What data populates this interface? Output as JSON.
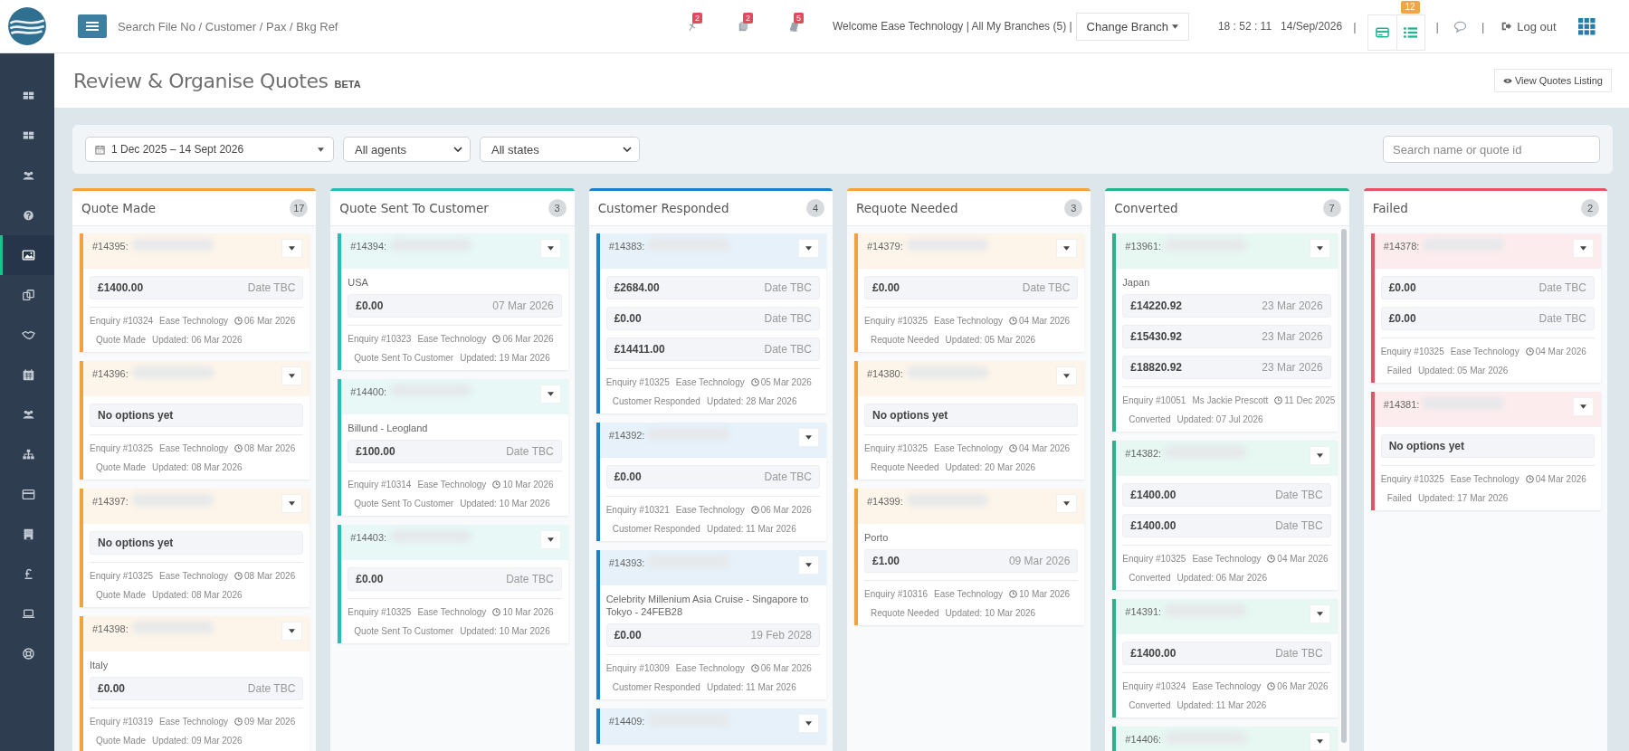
{
  "topbar": {
    "search": {
      "placeholder": "Search File No / Customer / Pax / Bkg Ref"
    },
    "notifications": [
      {
        "count": "2"
      },
      {
        "count": "2"
      },
      {
        "count": "5"
      }
    ],
    "welcome": "Welcome Ease Technology | All My Branches (5) |",
    "change_branch": "Change Branch",
    "time": "18 : 52 : 11",
    "date": "14/Sep/2026",
    "separator": "|",
    "view_badge": "12",
    "logout": "Log out"
  },
  "sidebar": {
    "items": [
      {
        "selected": false
      },
      {
        "selected": false
      },
      {
        "selected": false
      },
      {
        "selected": false
      },
      {
        "selected": true
      },
      {
        "selected": false
      },
      {
        "selected": false
      },
      {
        "selected": false
      },
      {
        "selected": false
      },
      {
        "selected": false
      },
      {
        "selected": false
      },
      {
        "selected": false
      },
      {
        "selected": false
      },
      {
        "selected": false
      },
      {
        "selected": false
      }
    ]
  },
  "page": {
    "title": "Review & Organise Quotes",
    "tag": "BETA",
    "view_button": "View Quotes Listing"
  },
  "filters": {
    "date_range": "1 Dec 2025 – 14 Sept 2026",
    "agents": "All agents",
    "states": "All states",
    "search": {
      "placeholder": "Search name or quote id"
    }
  },
  "columns": [
    {
      "title": "Quote Made",
      "count": "17",
      "color": "#f0a33c",
      "cards": [
        {
          "ref": "#14395:",
          "options": [
            {
              "price": "£1400.00",
              "date": "Date TBC"
            }
          ],
          "enquiry": "Enquiry #10324",
          "agent": "Ease Technology",
          "created": "06 Mar 2026",
          "status": "Quote Made",
          "updated": "Updated: 06 Mar 2026"
        },
        {
          "ref": "#14396:",
          "empty_text": "No options yet",
          "enquiry": "Enquiry #10325",
          "agent": "Ease Technology",
          "created": "08 Mar 2026",
          "status": "Quote Made",
          "updated": "Updated: 08 Mar 2026"
        },
        {
          "ref": "#14397:",
          "empty_text": "No options yet",
          "enquiry": "Enquiry #10325",
          "agent": "Ease Technology",
          "created": "08 Mar 2026",
          "status": "Quote Made",
          "updated": "Updated: 08 Mar 2026"
        },
        {
          "ref": "#14398:",
          "destination": "Italy",
          "options": [
            {
              "price": "£0.00",
              "date": "Date TBC"
            }
          ],
          "enquiry": "Enquiry #10319",
          "agent": "Ease Technology",
          "created": "09 Mar 2026",
          "status": "Quote Made",
          "updated": "Updated: 09 Mar 2026"
        }
      ]
    },
    {
      "title": "Quote Sent To Customer",
      "count": "3",
      "color": "#22c0b4",
      "cards": [
        {
          "ref": "#14394:",
          "destination": "USA",
          "options": [
            {
              "price": "£0.00",
              "date": "07 Mar 2026"
            }
          ],
          "enquiry": "Enquiry #10323",
          "agent": "Ease Technology",
          "created": "06 Mar 2026",
          "status": "Quote Sent To Customer",
          "updated": "Updated: 19 Mar 2026"
        },
        {
          "ref": "#14400:",
          "destination": "Billund - Leogland",
          "options": [
            {
              "price": "£100.00",
              "date": "Date TBC"
            }
          ],
          "enquiry": "Enquiry #10314",
          "agent": "Ease Technology",
          "created": "10 Mar 2026",
          "status": "Quote Sent To Customer",
          "updated": "Updated: 10 Mar 2026"
        },
        {
          "ref": "#14403:",
          "options": [
            {
              "price": "£0.00",
              "date": "Date TBC"
            }
          ],
          "enquiry": "Enquiry #10325",
          "agent": "Ease Technology",
          "created": "10 Mar 2026",
          "status": "Quote Sent To Customer",
          "updated": "Updated: 10 Mar 2026"
        }
      ]
    },
    {
      "title": "Customer Responded",
      "count": "4",
      "color": "#1f7fc4",
      "cards": [
        {
          "ref": "#14383:",
          "options": [
            {
              "price": "£2684.00",
              "date": "Date TBC"
            },
            {
              "price": "£0.00",
              "date": "Date TBC"
            },
            {
              "price": "£14411.00",
              "date": "Date TBC"
            }
          ],
          "enquiry": "Enquiry #10325",
          "agent": "Ease Technology",
          "created": "05 Mar 2026",
          "status": "Customer Responded",
          "updated": "Updated: 28 Mar 2026"
        },
        {
          "ref": "#14392:",
          "options": [
            {
              "price": "£0.00",
              "date": "Date TBC"
            }
          ],
          "enquiry": "Enquiry #10321",
          "agent": "Ease Technology",
          "created": "06 Mar 2026",
          "status": "Customer Responded",
          "updated": "Updated: 11 Mar 2026"
        },
        {
          "ref": "#14393:",
          "destination": "Celebrity Millenium Asia Cruise - Singapore to Tokyo - 24FEB28",
          "options": [
            {
              "price": "£0.00",
              "date": "19 Feb 2028"
            }
          ],
          "enquiry": "Enquiry #10309",
          "agent": "Ease Technology",
          "created": "06 Mar 2026",
          "status": "Customer Responded",
          "updated": "Updated: 11 Mar 2026"
        },
        {
          "ref": "#14409:"
        }
      ]
    },
    {
      "title": "Requote Needed",
      "count": "3",
      "color": "#f0a33c",
      "cards": [
        {
          "ref": "#14379:",
          "options": [
            {
              "price": "£0.00",
              "date": "Date TBC"
            }
          ],
          "enquiry": "Enquiry #10325",
          "agent": "Ease Technology",
          "created": "04 Mar 2026",
          "status": "Requote Needed",
          "updated": "Updated: 05 Mar 2026"
        },
        {
          "ref": "#14380:",
          "empty_text": "No options yet",
          "enquiry": "Enquiry #10325",
          "agent": "Ease Technology",
          "created": "04 Mar 2026",
          "status": "Requote Needed",
          "updated": "Updated: 20 Mar 2026"
        },
        {
          "ref": "#14399:",
          "destination": "Porto",
          "options": [
            {
              "price": "£1.00",
              "date": "09 Mar 2026"
            }
          ],
          "enquiry": "Enquiry #10316",
          "agent": "Ease Technology",
          "created": "10 Mar 2026",
          "status": "Requote Needed",
          "updated": "Updated: 10 Mar 2026"
        }
      ]
    },
    {
      "title": "Converted",
      "count": "7",
      "color": "#27b38c",
      "cards": [
        {
          "ref": "#13961:",
          "destination": "Japan",
          "options": [
            {
              "price": "£14220.92",
              "date": "23 Mar 2026"
            },
            {
              "price": "£15430.92",
              "date": "23 Mar 2026"
            },
            {
              "price": "£18820.92",
              "date": "23 Mar 2026"
            }
          ],
          "enquiry": "Enquiry #10051",
          "agent": "Ms Jackie Prescott",
          "created": "11 Dec 2025",
          "status": "Converted",
          "updated": "Updated: 07 Jul 2026"
        },
        {
          "ref": "#14382:",
          "options": [
            {
              "price": "£1400.00",
              "date": "Date TBC"
            },
            {
              "price": "£1400.00",
              "date": "Date TBC"
            }
          ],
          "enquiry": "Enquiry #10325",
          "agent": "Ease Technology",
          "created": "04 Mar 2026",
          "status": "Converted",
          "updated": "Updated: 06 Mar 2026"
        },
        {
          "ref": "#14391:",
          "options": [
            {
              "price": "£1400.00",
              "date": "Date TBC"
            }
          ],
          "enquiry": "Enquiry #10324",
          "agent": "Ease Technology",
          "created": "06 Mar 2026",
          "status": "Converted",
          "updated": "Updated: 11 Mar 2026"
        },
        {
          "ref": "#14406:"
        }
      ]
    },
    {
      "title": "Failed",
      "count": "2",
      "color": "#e25563",
      "cards": [
        {
          "ref": "#14378:",
          "options": [
            {
              "price": "£0.00",
              "date": "Date TBC"
            },
            {
              "price": "£0.00",
              "date": "Date TBC"
            }
          ],
          "enquiry": "Enquiry #10325",
          "agent": "Ease Technology",
          "created": "04 Mar 2026",
          "status": "Failed",
          "updated": "Updated: 05 Mar 2026"
        },
        {
          "ref": "#14381:",
          "empty_text": "No options yet",
          "enquiry": "Enquiry #10325",
          "agent": "Ease Technology",
          "created": "04 Mar 2026",
          "status": "Failed",
          "updated": "Updated: 17 Mar 2026"
        }
      ]
    }
  ]
}
